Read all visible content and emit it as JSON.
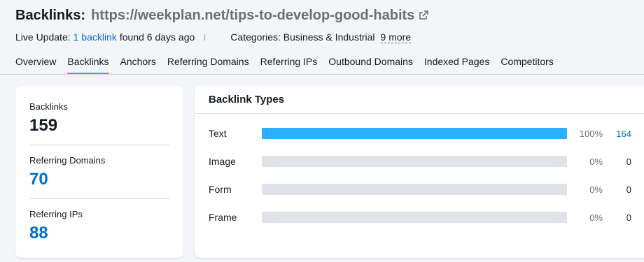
{
  "header": {
    "title_label": "Backlinks:",
    "url": "https://weekplan.net/tips-to-develop-good-habits",
    "live_update_label": "Live Update:",
    "backlink_link": "1 backlink",
    "found_text": "found 6 days ago",
    "categories_label": "Categories: Business & Industrial",
    "more_link": "9 more"
  },
  "tabs": [
    {
      "label": "Overview"
    },
    {
      "label": "Backlinks",
      "active": true
    },
    {
      "label": "Anchors"
    },
    {
      "label": "Referring Domains"
    },
    {
      "label": "Referring IPs"
    },
    {
      "label": "Outbound Domains"
    },
    {
      "label": "Indexed Pages"
    },
    {
      "label": "Competitors"
    }
  ],
  "summary": {
    "backlinks_label": "Backlinks",
    "backlinks_value": "159",
    "domains_label": "Referring Domains",
    "domains_value": "70",
    "ips_label": "Referring IPs",
    "ips_value": "88"
  },
  "backlink_types": {
    "title": "Backlink Types",
    "rows": [
      {
        "name": "Text",
        "percent_label": "100%",
        "count": "164",
        "fill": 1.0
      },
      {
        "name": "Image",
        "percent_label": "0%",
        "count": "0",
        "fill": 0
      },
      {
        "name": "Form",
        "percent_label": "0%",
        "count": "0",
        "fill": 0
      },
      {
        "name": "Frame",
        "percent_label": "0%",
        "count": "0",
        "fill": 0
      }
    ]
  },
  "colors": {
    "accent_blue": "#2bafff",
    "link_blue": "#006dca",
    "track_gray": "#e0e1e9"
  }
}
